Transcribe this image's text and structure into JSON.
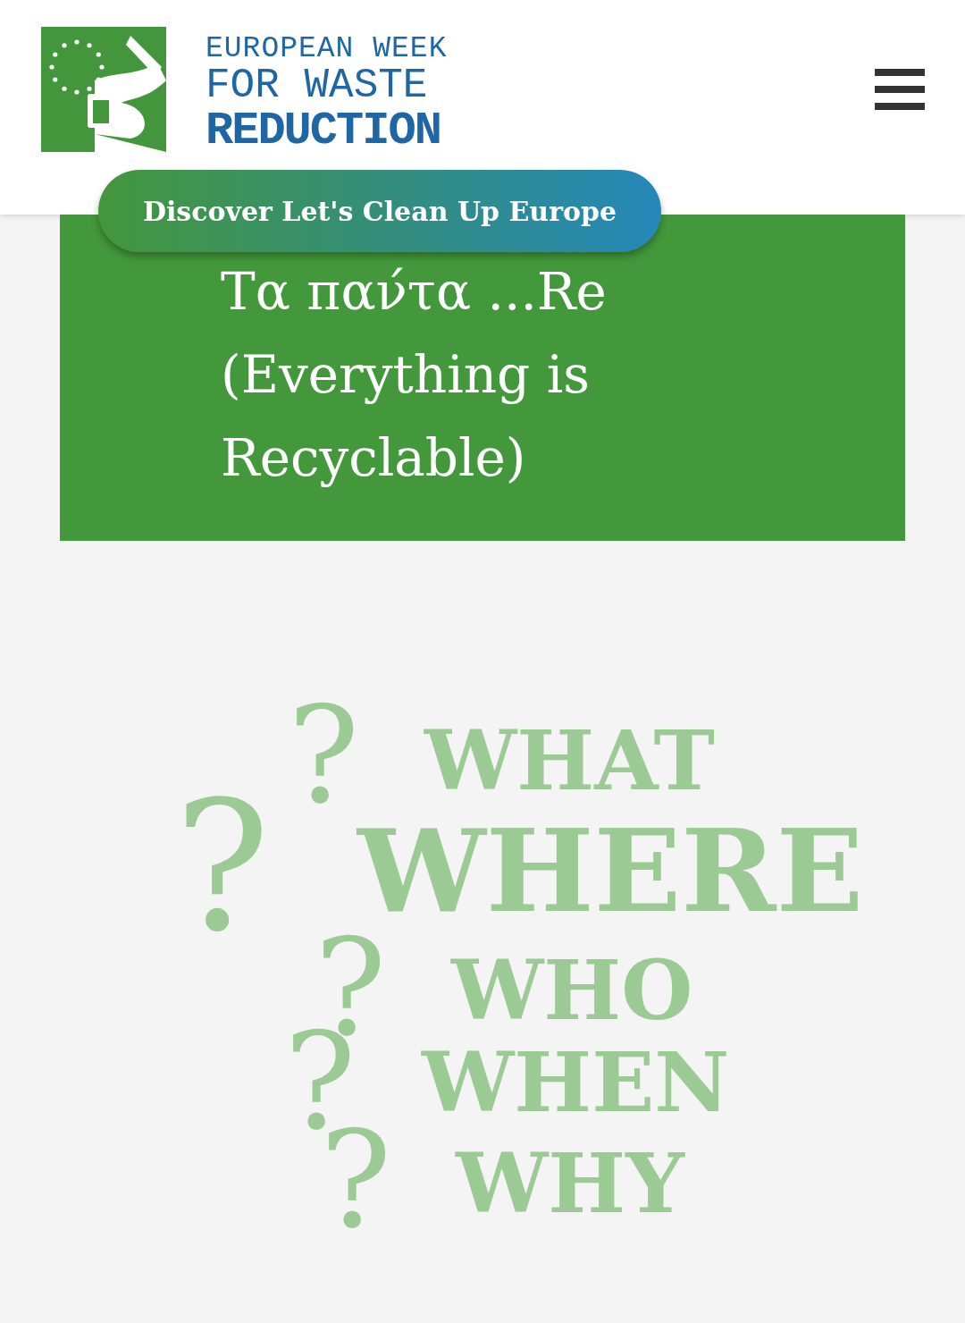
{
  "header": {
    "logo_lines": [
      "EUROPEAN WEEK",
      "FOR WASTE",
      "REDUCTION"
    ]
  },
  "cta_button": {
    "label": "Discover Let's Clean Up Europe"
  },
  "hero": {
    "title": "Τα παν́τα ...Re (Everything is Recyclable)"
  },
  "illustration": {
    "words": [
      {
        "text": "WHAT",
        "kind": "small"
      },
      {
        "text": "WHERE",
        "kind": "large"
      },
      {
        "text": "WHO",
        "kind": "small"
      },
      {
        "text": "WHEN",
        "kind": "small"
      },
      {
        "text": "WHY",
        "kind": "small"
      }
    ],
    "marks": [
      "?",
      "?",
      "?",
      "?",
      "?"
    ]
  }
}
